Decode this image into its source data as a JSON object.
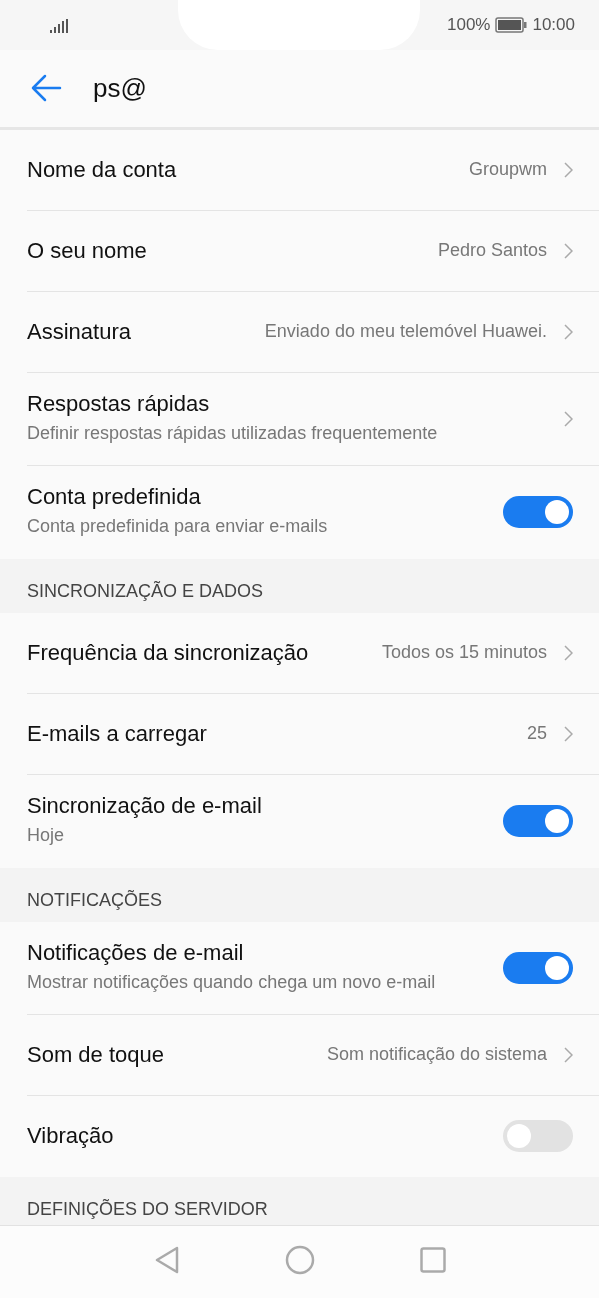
{
  "status_bar": {
    "battery": "100%",
    "time": "10:00"
  },
  "header": {
    "title": "ps@"
  },
  "sections": [
    {
      "items": [
        {
          "kind": "link",
          "label": "Nome da conta",
          "value": "Groupwm"
        },
        {
          "kind": "link",
          "label": "O seu nome",
          "value": "Pedro Santos"
        },
        {
          "kind": "link",
          "label": "Assinatura",
          "value": "Enviado do meu telemóvel Huawei."
        },
        {
          "kind": "link",
          "label": "Respostas rápidas",
          "subtitle": "Definir respostas rápidas utilizadas frequentemente"
        },
        {
          "kind": "toggle",
          "label": "Conta predefinida",
          "subtitle": "Conta predefinida para enviar e-mails",
          "on": true
        }
      ]
    },
    {
      "header": "SINCRONIZAÇÃO E DADOS",
      "items": [
        {
          "kind": "link",
          "label": "Frequência da sincronização",
          "value": "Todos os 15 minutos"
        },
        {
          "kind": "link",
          "label": "E-mails a carregar",
          "value": "25"
        },
        {
          "kind": "toggle",
          "label": "Sincronização de e-mail",
          "subtitle": "Hoje",
          "on": true
        }
      ]
    },
    {
      "header": "NOTIFICAÇÕES",
      "items": [
        {
          "kind": "toggle",
          "label": "Notificações de e-mail",
          "subtitle": "Mostrar notificações quando chega um novo e-mail",
          "on": true
        },
        {
          "kind": "link",
          "label": "Som de toque",
          "value": "Som notificação do sistema"
        },
        {
          "kind": "toggle",
          "label": "Vibração",
          "on": false
        }
      ]
    },
    {
      "header": "DEFINIÇÕES DO SERVIDOR"
    }
  ]
}
